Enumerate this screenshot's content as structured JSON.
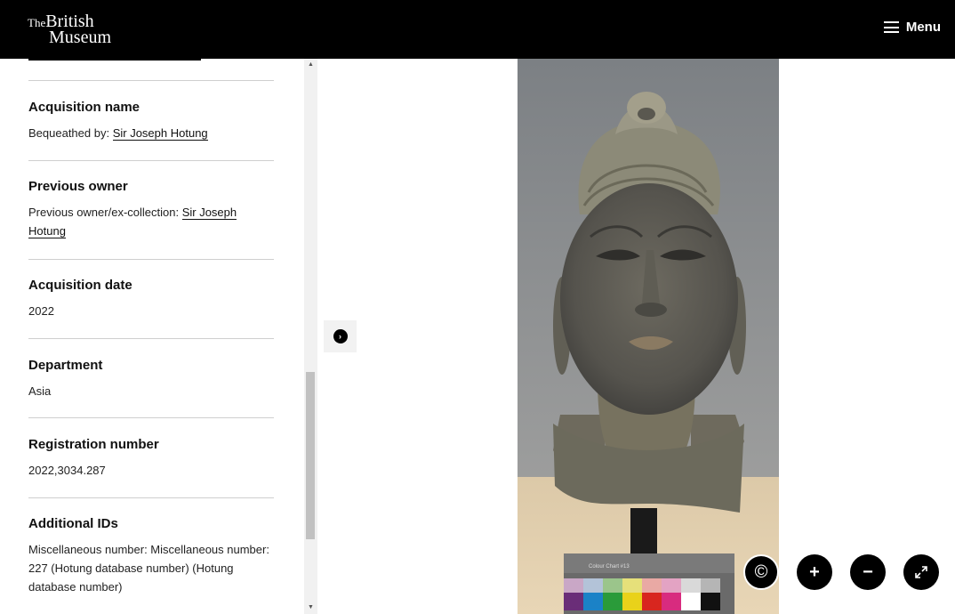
{
  "header": {
    "logo": {
      "the": "The",
      "british": "British",
      "museum": "Museum"
    },
    "menu_label": "Menu"
  },
  "sidebar": {
    "sections": [
      {
        "title": "Acquisition name",
        "prefix": "Bequeathed by: ",
        "link": "Sir Joseph Hotung"
      },
      {
        "title": "Previous owner",
        "prefix": "Previous owner/ex-collection: ",
        "link": "Sir Joseph Hotung"
      },
      {
        "title": "Acquisition date",
        "body": "2022"
      },
      {
        "title": "Department",
        "body": "Asia"
      },
      {
        "title": "Registration number",
        "body": "2022,3034.287"
      },
      {
        "title": "Additional IDs",
        "body": "Miscellaneous number: Miscellaneous number: 227 (Hotung database number) (Hotung database number)"
      }
    ]
  },
  "viewer": {
    "colour_chart_label": "Colour Chart #13",
    "controls": {
      "copyright": "©",
      "zoom_in": "+",
      "zoom_out": "−"
    }
  },
  "colors": {
    "header_bg": "#000000",
    "photo_bg": "#8b8d8f",
    "bronze": "#6b6a60"
  },
  "icons": [
    "menu-icon",
    "chevron-right-icon",
    "copyright-icon",
    "plus-icon",
    "minus-icon",
    "fullscreen-icon"
  ]
}
